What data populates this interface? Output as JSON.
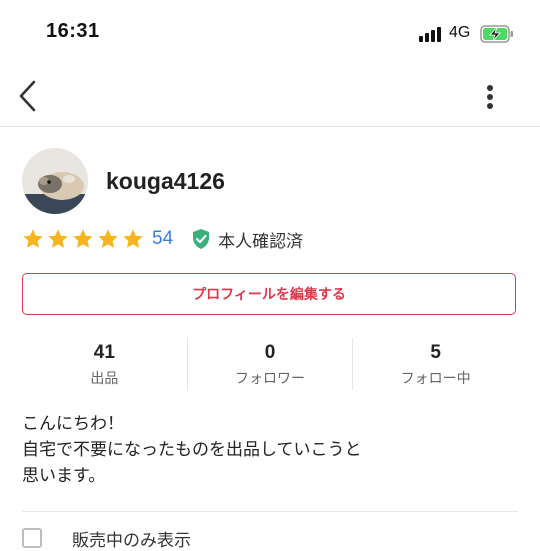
{
  "status_bar": {
    "time": "16:31",
    "network": "4G",
    "battery_icon": "battery-charging-icon"
  },
  "nav": {
    "back_icon": "chevron-left-icon",
    "menu_icon": "more-vertical-icon"
  },
  "profile": {
    "avatar_icon": "hamster-avatar",
    "username": "kouga4126",
    "rating": {
      "stars": 5,
      "count": "54"
    },
    "verified_label": "本人確認済",
    "edit_button_label": "プロフィールを編集する"
  },
  "stats": [
    {
      "value": "41",
      "label": "出品"
    },
    {
      "value": "0",
      "label": "フォロワー"
    },
    {
      "value": "5",
      "label": "フォロー中"
    }
  ],
  "bio": {
    "lines": [
      "こんにちわ！",
      "自宅で不要になったものを出品していこうと",
      "思います。"
    ]
  },
  "filter": {
    "label": "販売中のみ表示"
  },
  "colors": {
    "accent": "#e0364c",
    "star": "#f6b51e",
    "link": "#3a7fd4",
    "verified": "#3bb07a"
  }
}
